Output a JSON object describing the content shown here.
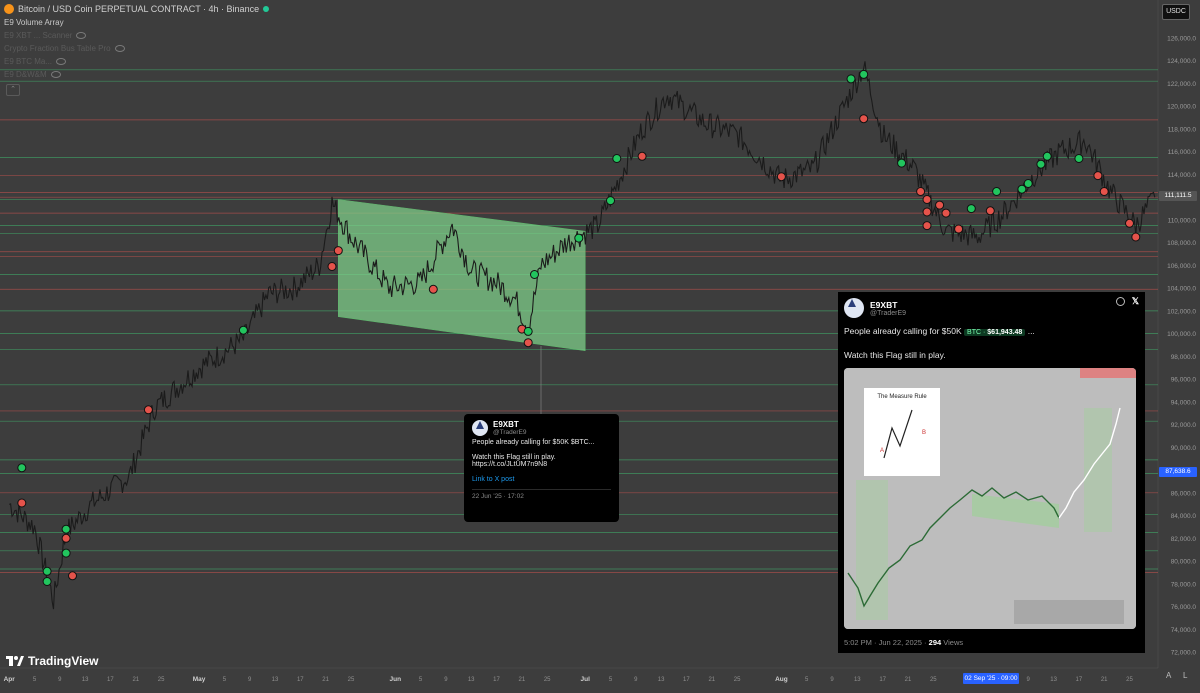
{
  "header": {
    "symbol": "Bitcoin / USD Coin PERPETUAL CONTRACT · 4h · Binance"
  },
  "indicators": [
    {
      "label": "E9 Volume Array"
    },
    {
      "label": "E9 XBT ... Scanner"
    },
    {
      "label": "Crypto Fraction Bus Table Pro"
    },
    {
      "label": "E9 BTC Ma..."
    },
    {
      "label": "E9 D&W&M"
    }
  ],
  "currency_button": "USDC",
  "logo_text": "TradingView",
  "price_axis": {
    "labels": [
      "126,000.0",
      "124,000.0",
      "122,000.0",
      "120,000.0",
      "118,000.0",
      "116,000.0",
      "114,000.0",
      "112,000.0",
      "110,000.0",
      "108,000.0",
      "106,000.0",
      "104,000.0",
      "102,000.0",
      "100,000.0",
      "98,000.0",
      "96,000.0",
      "94,000.0",
      "92,000.0",
      "90,000.0",
      "88,000.0",
      "86,000.0",
      "84,000.0",
      "82,000.0",
      "80,000.0",
      "78,000.0",
      "76,000.0",
      "74,000.0",
      "72,000.0"
    ],
    "current_price": "111,111.5",
    "cursor_price": "87,638.6"
  },
  "time_axis": {
    "labels": [
      "Apr",
      "5",
      "9",
      "13",
      "17",
      "21",
      "25",
      "May",
      "5",
      "9",
      "13",
      "17",
      "21",
      "25",
      "Jun",
      "5",
      "9",
      "13",
      "17",
      "21",
      "25",
      "Jul",
      "5",
      "9",
      "13",
      "17",
      "21",
      "25",
      "Aug",
      "5",
      "9",
      "13",
      "17",
      "21",
      "25",
      "Sep",
      "9",
      "13",
      "17",
      "21",
      "25"
    ],
    "cursor_date": "02 Sep '25 · 09:00"
  },
  "small_tweet": {
    "name": "E9XBT",
    "handle": "@TraderE9",
    "line1": "People already calling for $50K $BTC...",
    "line2": "Watch this Flag still in play.",
    "link_url": "https://t.co/JLtUM7n9N8",
    "link_label": "Link to X post",
    "date": "22 Jun '25 · 17:02"
  },
  "big_tweet": {
    "name": "E9XBT",
    "handle": "@TraderE9",
    "text_prefix": "People already calling for $50K",
    "pill_label": "BTC",
    "pill_price": "$61,943.48",
    "text_suffix": "...",
    "line2": "Watch this Flag still in play.",
    "time": "5:02 PM · Jun 22, 2025 ·",
    "views_count": "294",
    "views_label": "Views",
    "inner_title": "The Measure Rule",
    "inner_label_a": "A",
    "inner_label_b": "B"
  },
  "colors": {
    "background": "#3d3d3d",
    "up_marker": "#22c55e",
    "down_marker": "#e5534b",
    "flag_fill": "#7fd18b",
    "green_line": "#3fae6a",
    "red_line": "#c0504d"
  },
  "chart_data": {
    "type": "line",
    "title": "",
    "xlabel": "",
    "ylabel": "",
    "ylim": [
      71000,
      127000
    ],
    "x_dates": [
      "2025-04-01",
      "2025-04-05",
      "2025-04-08",
      "2025-04-10",
      "2025-04-14",
      "2025-04-20",
      "2025-04-24",
      "2025-05-01",
      "2025-05-08",
      "2025-05-12",
      "2025-05-16",
      "2025-05-20",
      "2025-05-22",
      "2025-05-25",
      "2025-05-31",
      "2025-06-05",
      "2025-06-10",
      "2025-06-13",
      "2025-06-17",
      "2025-06-20",
      "2025-06-22",
      "2025-06-24",
      "2025-06-28",
      "2025-07-03",
      "2025-07-10",
      "2025-07-14",
      "2025-07-20",
      "2025-07-25",
      "2025-08-01",
      "2025-08-06",
      "2025-08-10",
      "2025-08-14",
      "2025-08-17",
      "2025-08-22",
      "2025-08-27",
      "2025-09-01",
      "2025-09-05",
      "2025-09-10",
      "2025-09-14",
      "2025-09-18",
      "2025-09-22",
      "2025-09-26",
      "2025-09-29"
    ],
    "series": [
      {
        "values": [
          85000,
          83000,
          76500,
          82500,
          85000,
          87500,
          93500,
          97000,
          99500,
          103500,
          104000,
          106000,
          111500,
          108500,
          104000,
          104500,
          109500,
          105500,
          104500,
          103000,
          100500,
          106000,
          108000,
          109500,
          118000,
          121000,
          118500,
          117500,
          113500,
          114500,
          119000,
          123500,
          117500,
          114500,
          109000,
          108500,
          110500,
          114000,
          116000,
          117000,
          112500,
          109500,
          112000
        ]
      }
    ],
    "flag": {
      "top_left": [
        "2025-05-23",
        111800
      ],
      "top_right": [
        "2025-07-01",
        109000
      ],
      "bottom_left": [
        "2025-05-23",
        101500
      ],
      "bottom_right": [
        "2025-07-01",
        98500
      ]
    },
    "green_levels": [
      123200,
      122200,
      115500,
      111800,
      109500,
      108800,
      105200,
      102000,
      100000,
      98600,
      95500,
      92300,
      88900,
      87700,
      84100,
      82500,
      80900,
      79300
    ],
    "red_levels": [
      118800,
      113900,
      112400,
      112000,
      110600,
      107200,
      106800,
      103900,
      93200,
      86000,
      79000
    ],
    "markers": [
      {
        "date": "2025-04-03",
        "price": 88200,
        "kind": "up"
      },
      {
        "date": "2025-04-03",
        "price": 85100,
        "kind": "down"
      },
      {
        "date": "2025-04-07",
        "price": 79100,
        "kind": "up"
      },
      {
        "date": "2025-04-07",
        "price": 78200,
        "kind": "up"
      },
      {
        "date": "2025-04-10",
        "price": 82800,
        "kind": "up"
      },
      {
        "date": "2025-04-10",
        "price": 82000,
        "kind": "down"
      },
      {
        "date": "2025-04-10",
        "price": 80700,
        "kind": "up"
      },
      {
        "date": "2025-04-11",
        "price": 78700,
        "kind": "down"
      },
      {
        "date": "2025-04-23",
        "price": 93300,
        "kind": "down"
      },
      {
        "date": "2025-05-08",
        "price": 100300,
        "kind": "up"
      },
      {
        "date": "2025-05-22",
        "price": 105900,
        "kind": "down"
      },
      {
        "date": "2025-05-23",
        "price": 107300,
        "kind": "down"
      },
      {
        "date": "2025-06-07",
        "price": 103900,
        "kind": "down"
      },
      {
        "date": "2025-06-21",
        "price": 100400,
        "kind": "down"
      },
      {
        "date": "2025-06-22",
        "price": 99200,
        "kind": "down"
      },
      {
        "date": "2025-06-22",
        "price": 100200,
        "kind": "up"
      },
      {
        "date": "2025-06-23",
        "price": 105200,
        "kind": "up"
      },
      {
        "date": "2025-06-30",
        "price": 108400,
        "kind": "up"
      },
      {
        "date": "2025-07-05",
        "price": 111700,
        "kind": "up"
      },
      {
        "date": "2025-07-06",
        "price": 115400,
        "kind": "up"
      },
      {
        "date": "2025-07-10",
        "price": 115600,
        "kind": "down"
      },
      {
        "date": "2025-08-01",
        "price": 113800,
        "kind": "down"
      },
      {
        "date": "2025-08-12",
        "price": 122400,
        "kind": "up"
      },
      {
        "date": "2025-08-14",
        "price": 122800,
        "kind": "up"
      },
      {
        "date": "2025-08-14",
        "price": 118900,
        "kind": "down"
      },
      {
        "date": "2025-08-20",
        "price": 115000,
        "kind": "up"
      },
      {
        "date": "2025-08-23",
        "price": 112500,
        "kind": "down"
      },
      {
        "date": "2025-08-24",
        "price": 111800,
        "kind": "down"
      },
      {
        "date": "2025-08-24",
        "price": 110700,
        "kind": "down"
      },
      {
        "date": "2025-08-24",
        "price": 109500,
        "kind": "down"
      },
      {
        "date": "2025-08-26",
        "price": 111300,
        "kind": "down"
      },
      {
        "date": "2025-08-27",
        "price": 110600,
        "kind": "down"
      },
      {
        "date": "2025-08-29",
        "price": 109200,
        "kind": "down"
      },
      {
        "date": "2025-08-31",
        "price": 111000,
        "kind": "up"
      },
      {
        "date": "2025-09-03",
        "price": 110800,
        "kind": "down"
      },
      {
        "date": "2025-09-04",
        "price": 112500,
        "kind": "up"
      },
      {
        "date": "2025-09-08",
        "price": 112700,
        "kind": "up"
      },
      {
        "date": "2025-09-09",
        "price": 113200,
        "kind": "up"
      },
      {
        "date": "2025-09-11",
        "price": 114900,
        "kind": "up"
      },
      {
        "date": "2025-09-12",
        "price": 115600,
        "kind": "up"
      },
      {
        "date": "2025-09-17",
        "price": 115400,
        "kind": "up"
      },
      {
        "date": "2025-09-20",
        "price": 113900,
        "kind": "down"
      },
      {
        "date": "2025-09-21",
        "price": 112500,
        "kind": "down"
      },
      {
        "date": "2025-09-25",
        "price": 109700,
        "kind": "down"
      },
      {
        "date": "2025-09-26",
        "price": 108500,
        "kind": "down"
      }
    ]
  }
}
